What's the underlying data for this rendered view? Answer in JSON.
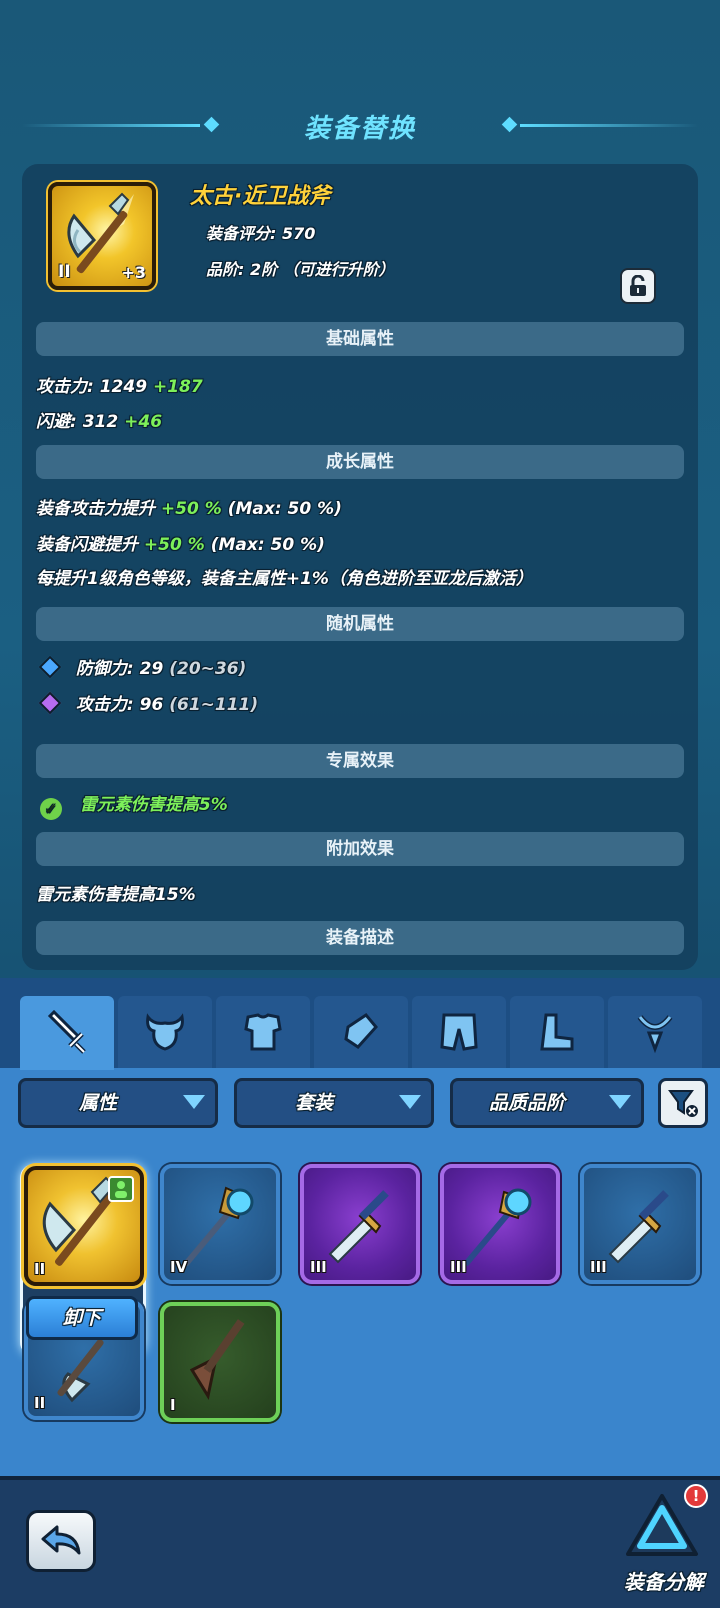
{
  "header": {
    "title": "装备替换"
  },
  "item": {
    "name": "太古·近卫战斧",
    "score": "装备评分: 570",
    "grade": "品阶: 2阶 （可进行升阶）",
    "tier": "II",
    "plus": "+3"
  },
  "sections": {
    "base": "基础属性",
    "growth": "成长属性",
    "random": "随机属性",
    "exclusive": "专属效果",
    "extra": "附加效果",
    "desc": "装备描述"
  },
  "base_stats": [
    {
      "label": "攻击力: 1249",
      "bonus": "+187"
    },
    {
      "label": "闪避: 312",
      "bonus": "+46"
    }
  ],
  "growth_stats": [
    {
      "label": "装备攻击力提升",
      "bonus": "+50 %",
      "max": "(Max: 50 %)"
    },
    {
      "label": "装备闪避提升",
      "bonus": "+50 %",
      "max": "(Max: 50 %)"
    },
    {
      "label": "每提升1级角色等级，装备主属性+1%（角色进阶至亚龙后激活）"
    }
  ],
  "random_stats": [
    {
      "label": "防御力: 29",
      "range": "(20~36)",
      "gem_color": "#4aa8ff"
    },
    {
      "label": "攻击力: 96",
      "range": "(61~111)",
      "gem_color": "#b86cf0"
    }
  ],
  "exclusive_effect": "雷元素伤害提高5%",
  "extra_effect": "雷元素伤害提高15%",
  "tabs": [
    "weapon-icon",
    "helmet-icon",
    "armor-icon",
    "bracer-icon",
    "pants-icon",
    "boots-icon",
    "accessory-icon"
  ],
  "filters": {
    "attribute": "属性",
    "set": "套装",
    "quality": "品质品阶"
  },
  "inventory": [
    {
      "tier": "II",
      "quality": "gold",
      "equipped": true
    },
    {
      "tier": "IV",
      "quality": "blue"
    },
    {
      "tier": "III",
      "quality": "purple"
    },
    {
      "tier": "III",
      "quality": "purple"
    },
    {
      "tier": "III",
      "quality": "blue"
    },
    {
      "tier": "II",
      "quality": "blue"
    },
    {
      "tier": "I",
      "quality": "green"
    }
  ],
  "unequip_label": "卸下",
  "footer": {
    "salvage_label": "装备分解",
    "badge": "!"
  },
  "colors": {
    "accent": "#6fe3ff",
    "gold": "#ffd23a",
    "bonus_green": "#7df05a"
  }
}
